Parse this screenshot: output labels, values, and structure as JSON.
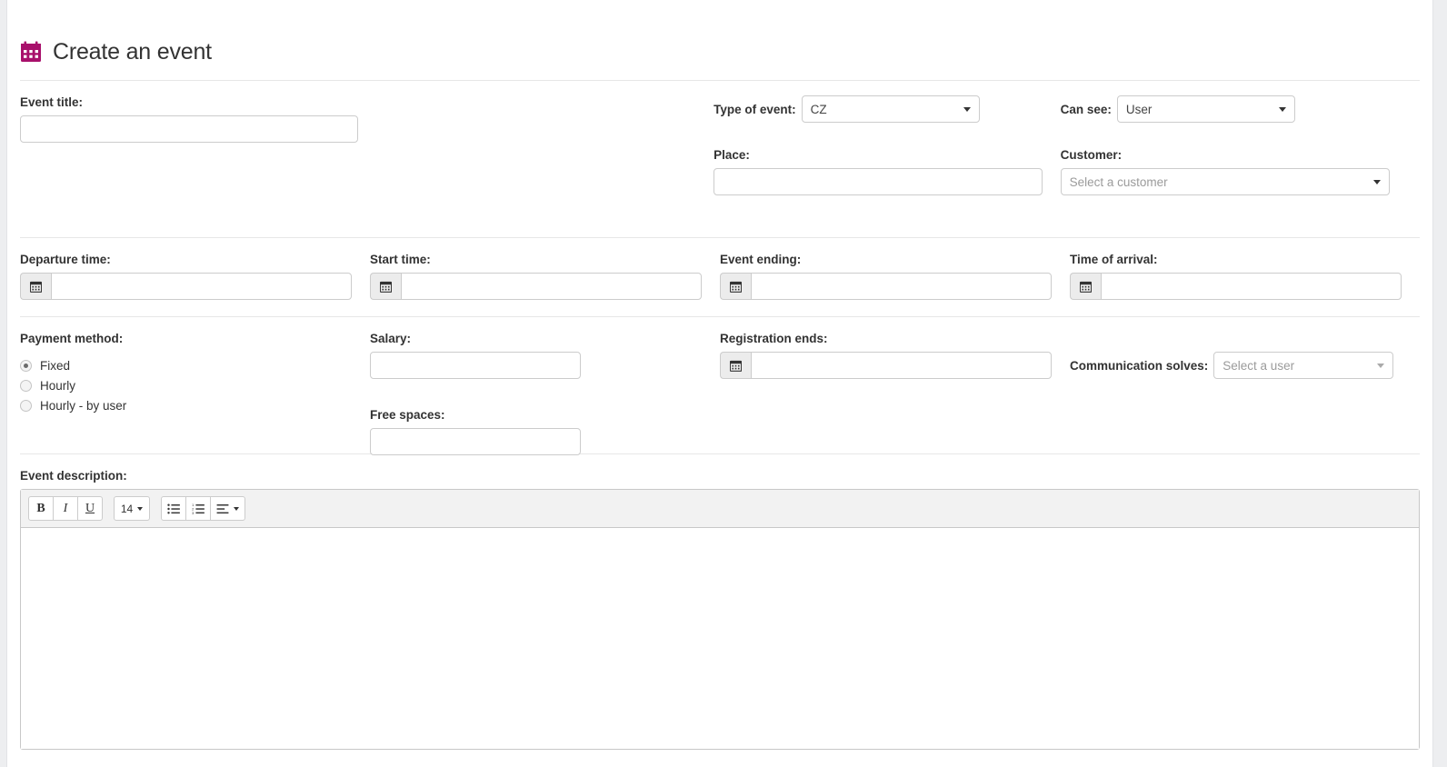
{
  "header": {
    "title": "Create an event",
    "icon": "calendar-icon",
    "icon_color": "#a8106b"
  },
  "form": {
    "event_title": {
      "label": "Event title:",
      "value": "",
      "placeholder": ""
    },
    "type_of_event": {
      "label": "Type of event:",
      "value": "CZ",
      "icon": "chevron-down-icon"
    },
    "can_see": {
      "label": "Can see:",
      "value": "User",
      "icon": "chevron-down-icon"
    },
    "place": {
      "label": "Place:",
      "value": "",
      "placeholder": ""
    },
    "customer": {
      "label": "Customer:",
      "value": "Select a customer",
      "is_placeholder": true,
      "icon": "chevron-down-icon"
    },
    "departure_time": {
      "label": "Departure time:",
      "value": "",
      "placeholder": "",
      "icon": "calendar-icon"
    },
    "start_time": {
      "label": "Start time:",
      "value": "",
      "placeholder": "",
      "icon": "calendar-icon"
    },
    "event_ending": {
      "label": "Event ending:",
      "value": "",
      "placeholder": "",
      "icon": "calendar-icon"
    },
    "time_of_arrival": {
      "label": "Time of arrival:",
      "value": "",
      "placeholder": "",
      "icon": "calendar-icon"
    },
    "payment_method": {
      "label": "Payment method:",
      "options": [
        {
          "label": "Fixed",
          "selected": true
        },
        {
          "label": "Hourly",
          "selected": false
        },
        {
          "label": "Hourly - by user",
          "selected": false
        }
      ]
    },
    "salary": {
      "label": "Salary:",
      "value": "",
      "placeholder": ""
    },
    "free_spaces": {
      "label": "Free spaces:",
      "value": "",
      "placeholder": ""
    },
    "registration_ends": {
      "label": "Registration ends:",
      "value": "",
      "placeholder": "",
      "icon": "calendar-icon"
    },
    "communication_solves": {
      "label": "Communication solves:",
      "value": "Select a user",
      "is_placeholder": true,
      "icon": "chevron-down-icon"
    },
    "event_description": {
      "label": "Event description:",
      "value": ""
    }
  },
  "editor": {
    "toolbar": {
      "bold": "B",
      "italic": "I",
      "underline": "U",
      "font_size": "14",
      "unordered_list_icon": "bullet-list-icon",
      "ordered_list_icon": "numbered-list-icon",
      "align_icon": "align-left-icon"
    },
    "content": ""
  },
  "colors": {
    "accent": "#a8106b",
    "page_background": "#edeef0",
    "card_background": "#ffffff",
    "border": "#cccccc",
    "divider": "#e7e7e7",
    "text": "#333333",
    "placeholder_text": "#9b9b9b"
  }
}
